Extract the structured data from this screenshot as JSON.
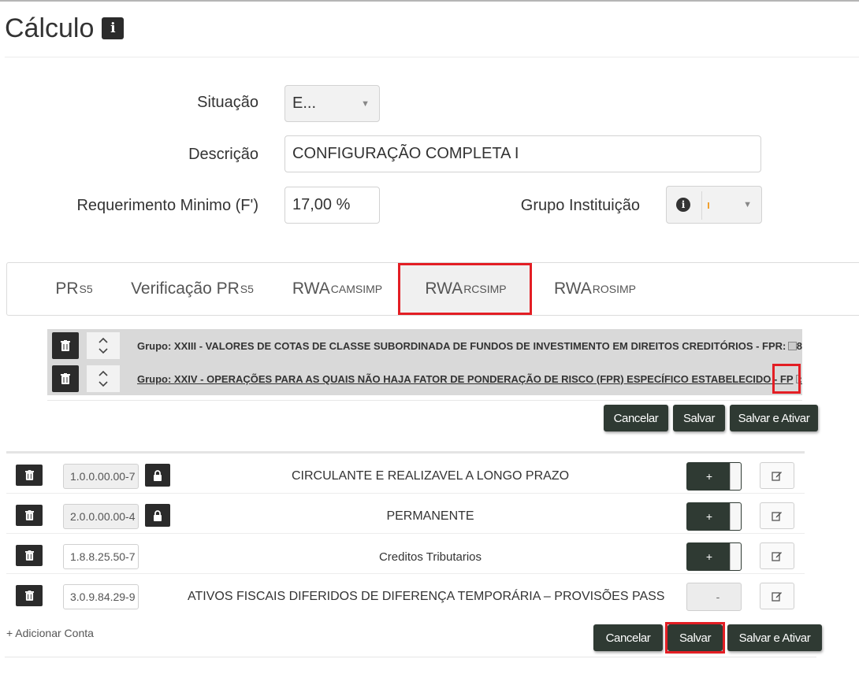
{
  "page": {
    "title": "Cálculo",
    "title_info_icon": "info-icon"
  },
  "form": {
    "situacao_label": "Situação",
    "situacao_value": "E...",
    "descricao_label": "Descrição",
    "descricao_value": "CONFIGURAÇÃO COMPLETA I",
    "requerimento_label": "Requerimento Minimo (F')",
    "requerimento_value": "17,00 %",
    "grupo_instituicao_label": "Grupo Instituição",
    "grupo_instituicao_value": ""
  },
  "tabs": [
    {
      "base": "PR",
      "sub": "S5",
      "active": false
    },
    {
      "base": "Verificação PR",
      "sub": "S5",
      "active": false
    },
    {
      "base": "RWA",
      "sub": "CAMSIMP",
      "active": false
    },
    {
      "base": "RWA",
      "sub": "RCSIMP",
      "active": true
    },
    {
      "base": "RWA",
      "sub": "ROSIMP",
      "active": false
    }
  ],
  "groups": [
    {
      "text": "Grupo: XXIII - VALORES DE COTAS DE CLASSE SUBORDINADA DE FUNDOS DE INVESTIMENTO EM DIREITOS CREDITÓRIOS - FPR:",
      "suffix": "8",
      "underlined": false
    },
    {
      "text": "Grupo: XXIV - OPERAÇÕES PARA AS QUAIS NÃO HAJA FATOR DE PONDERAÇÃO DE RISCO (FPR) ESPECÍFICO ESTABELECIDO - FP",
      "suffix": ":",
      "underlined": true
    }
  ],
  "group_actions": {
    "cancel": "Cancelar",
    "save": "Salvar",
    "save_activate": "Salvar e Ativar"
  },
  "accounts": [
    {
      "code": "1.0.0.00.00-7",
      "locked": true,
      "description": "CIRCULANTE E REALIZAVEL A LONGO PRAZO",
      "sign": "+",
      "active": true
    },
    {
      "code": "2.0.0.00.00-4",
      "locked": true,
      "description": "PERMANENTE",
      "sign": "+",
      "active": true
    },
    {
      "code": "1.8.8.25.50-7",
      "locked": false,
      "description": "Creditos Tributarios",
      "sign": "+",
      "active": true
    },
    {
      "code": "3.0.9.84.29-9",
      "locked": false,
      "description": "ATIVOS FISCAIS DIFERIDOS DE DIFERENÇA TEMPORÁRIA – PROVISÕES PASS",
      "sign": "-",
      "active": false
    }
  ],
  "account_actions": {
    "add": "+ Adicionar Conta",
    "cancel": "Cancelar",
    "save": "Salvar",
    "save_activate": "Salvar e Ativar"
  },
  "icons": {
    "trash": "trash-icon",
    "reorder": "chevron-up-down-icon",
    "lock": "lock-icon",
    "edit": "edit-icon",
    "dropdown": "caret-down-icon"
  },
  "colors": {
    "highlight": "#e31e24",
    "dark_button": "#2f3a33",
    "group_row": "#d9d9d9"
  }
}
